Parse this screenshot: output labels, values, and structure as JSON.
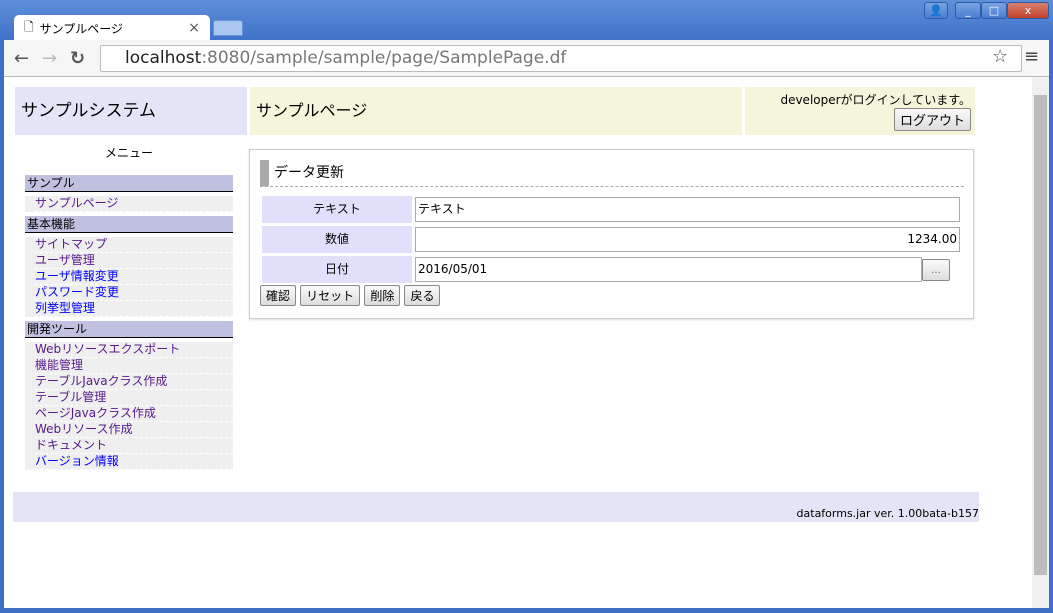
{
  "browser": {
    "tab_title": "サンプルページ",
    "tab_close": "×",
    "url_host": "localhost",
    "url_rest": ":8080/sample/sample/page/SamplePage.df",
    "win_user": "👤",
    "win_min": "_",
    "win_max": "□",
    "win_close": "x"
  },
  "header": {
    "system_name": "サンプルシステム",
    "page_name": "サンプルページ",
    "login_msg": "developerがログインしています。",
    "logout": "ログアウト"
  },
  "menu": {
    "title": "メニュー",
    "groups": [
      {
        "label": "サンプル",
        "items": [
          "サンプルページ"
        ]
      },
      {
        "label": "基本機能",
        "items": [
          "サイトマップ",
          "ユーザ管理",
          "ユーザ情報変更",
          "パスワード変更",
          "列挙型管理"
        ]
      },
      {
        "label": "開発ツール",
        "items": [
          "Webリソースエクスポート",
          "機能管理",
          "テーブルJavaクラス作成",
          "テーブル管理",
          "ページJavaクラス作成",
          "Webリソース作成",
          "ドキュメント",
          "バージョン情報"
        ]
      }
    ]
  },
  "form": {
    "title": "データ更新",
    "fields": [
      {
        "label": "テキスト",
        "value": "テキスト"
      },
      {
        "label": "数値",
        "value": "1234.00"
      },
      {
        "label": "日付",
        "value": "2016/05/01"
      }
    ],
    "date_picker": "...",
    "buttons": [
      "確認",
      "リセット",
      "削除",
      "戻る"
    ]
  },
  "footer": {
    "version": "dataforms.jar ver. 1.00bata-b157"
  }
}
